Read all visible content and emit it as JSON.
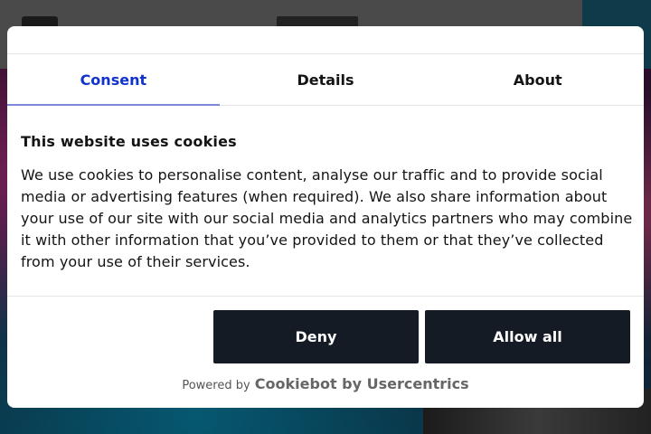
{
  "tabs": [
    {
      "label": "Consent",
      "active": true
    },
    {
      "label": "Details",
      "active": false
    },
    {
      "label": "About",
      "active": false
    }
  ],
  "consent": {
    "title": "This website uses cookies",
    "body": "We use cookies to personalise content, analyse our traffic and to provide social media or advertising features (when required). We also share information about your use of our site with our social media and analytics partners who may combine it with other information that you’ve provided to them or that they’ve collected from your use of their services."
  },
  "buttons": {
    "deny": "Deny",
    "allow_all": "Allow all"
  },
  "footer": {
    "powered_by": "Powered by",
    "brand": "Cookiebot by Usercentrics"
  },
  "colors": {
    "active_tab": "#1032cf",
    "button_bg": "#141b24",
    "button_text": "#ffffff"
  }
}
